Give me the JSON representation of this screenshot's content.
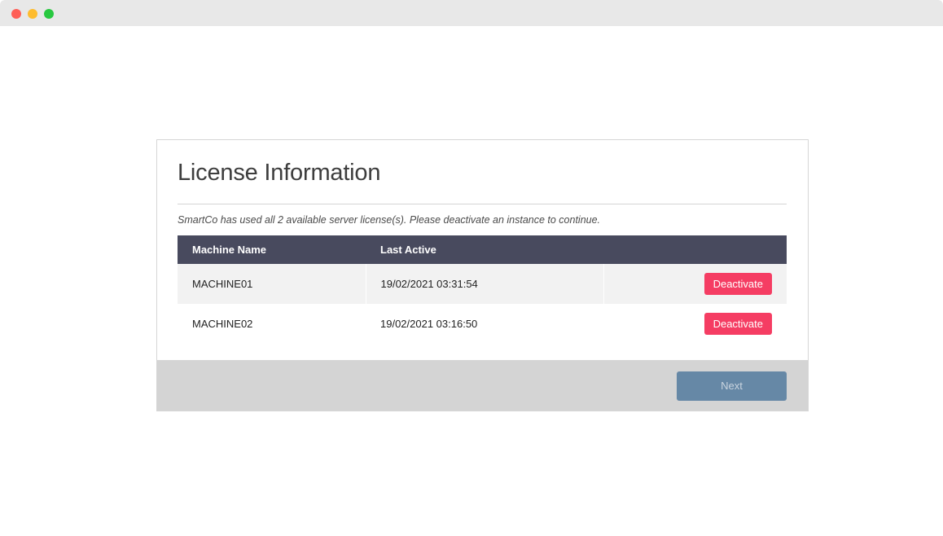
{
  "window": {
    "controls": [
      "close",
      "minimize",
      "maximize"
    ]
  },
  "dialog": {
    "title": "License Information",
    "message": "SmartCo has used all 2 available server license(s). Please deactivate an instance to continue.",
    "table": {
      "headers": [
        "Machine Name",
        "Last Active",
        ""
      ],
      "rows": [
        {
          "machine": "MACHINE01",
          "last_active": "19/02/2021 03:31:54",
          "action": "Deactivate"
        },
        {
          "machine": "MACHINE02",
          "last_active": "19/02/2021 03:16:50",
          "action": "Deactivate"
        }
      ]
    },
    "footer": {
      "next_label": "Next"
    }
  },
  "colors": {
    "header_bg": "#484a5e",
    "deactivate": "#f53d63",
    "next_button": "#6688a6",
    "footer_bg": "#d4d4d4"
  }
}
